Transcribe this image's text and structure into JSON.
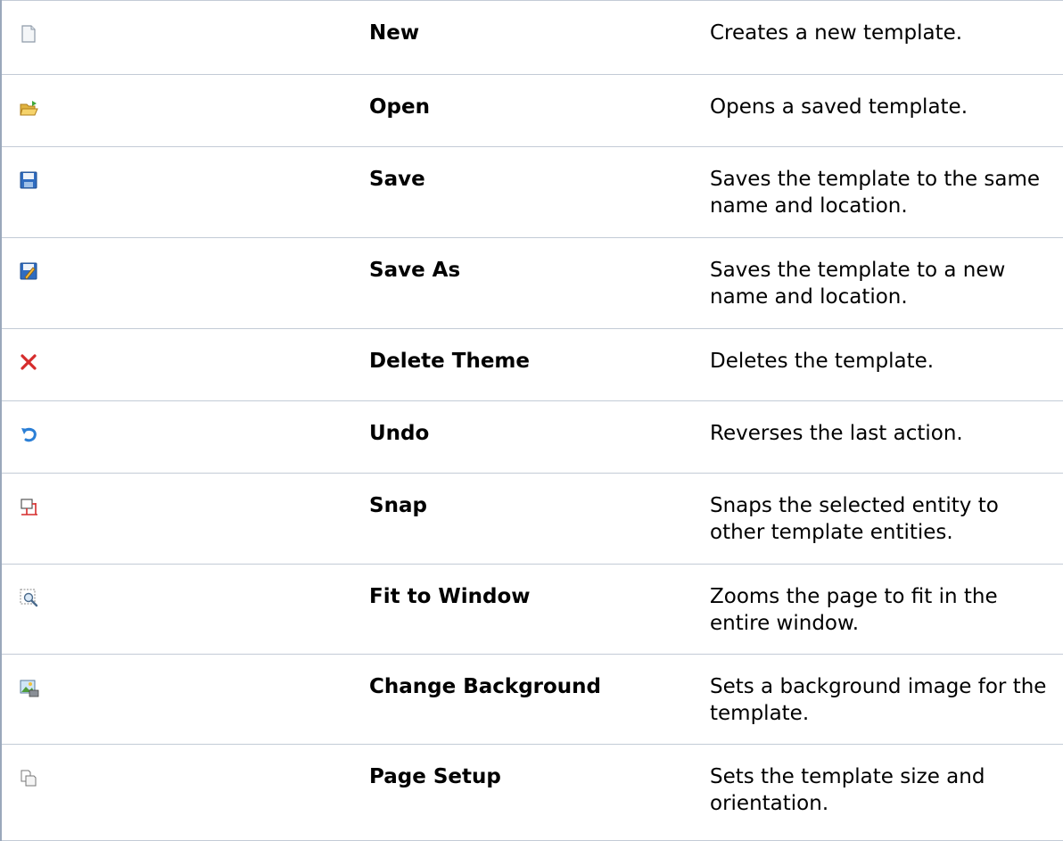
{
  "rows": [
    {
      "icon": "new-document-icon",
      "name": "New",
      "description": "Creates a new template."
    },
    {
      "icon": "open-folder-icon",
      "name": "Open",
      "description": "Opens a saved template."
    },
    {
      "icon": "save-disk-icon",
      "name": "Save",
      "description": "Saves the template to the same name and location."
    },
    {
      "icon": "save-as-icon",
      "name": "Save As",
      "description": "Saves the template to a new name and location."
    },
    {
      "icon": "delete-x-icon",
      "name": "Delete Theme",
      "description": "Deletes the template."
    },
    {
      "icon": "undo-arrow-icon",
      "name": "Undo",
      "description": "Reverses the last action."
    },
    {
      "icon": "snap-icon",
      "name": "Snap",
      "description": "Snaps the selected entity to other template entities."
    },
    {
      "icon": "zoom-fit-icon",
      "name": "Fit to Window",
      "description": "Zooms the page to fit in the entire window."
    },
    {
      "icon": "background-image-icon",
      "name": "Change Background",
      "description": "Sets a background image for the template."
    },
    {
      "icon": "page-setup-icon",
      "name": "Page Setup",
      "description": "Sets the template size and orientation."
    }
  ],
  "colors": {
    "border": "#c3cbd6",
    "outer_border": "#9aa8bb",
    "text": "#000000"
  }
}
